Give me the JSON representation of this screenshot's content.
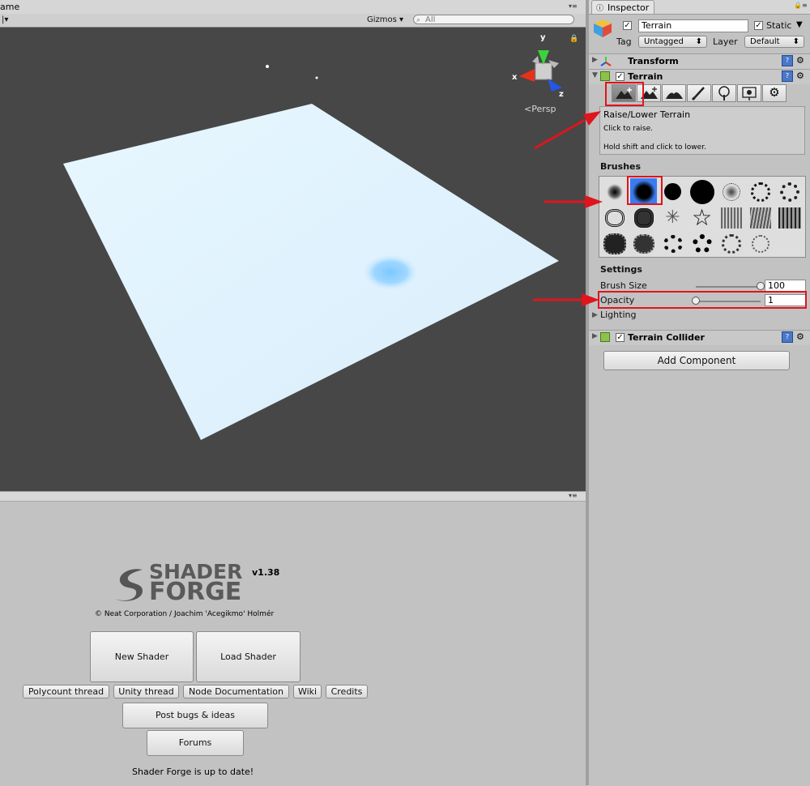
{
  "scene": {
    "tab_title": "ame",
    "toolbar": {
      "gizmos_label": "Gizmos",
      "search_placeholder": "All"
    },
    "gizmo": {
      "y_label": "y",
      "x_label": "x",
      "z_label": "z",
      "persp_label": "Persp"
    }
  },
  "shader_forge": {
    "logo_top": "SHADER",
    "logo_bottom": "FORGE",
    "version": "v1.38",
    "credit": "© Neat Corporation / Joachim 'Acegikmo' Holmér",
    "buttons": {
      "new_shader": "New Shader",
      "load_shader": "Load Shader",
      "polycount": "Polycount thread",
      "unity_thread": "Unity thread",
      "node_docs": "Node Documentation",
      "wiki": "Wiki",
      "credits": "Credits",
      "post_bugs": "Post bugs & ideas",
      "forums": "Forums"
    },
    "status": "Shader Forge is up to date!"
  },
  "inspector": {
    "tab_title": "Inspector",
    "object_name": "Terrain",
    "static_label": "Static",
    "tag_label": "Tag",
    "tag_value": "Untagged",
    "layer_label": "Layer",
    "layer_value": "Default",
    "components": {
      "transform": "Transform",
      "terrain": "Terrain",
      "terrain_collider": "Terrain Collider"
    },
    "tool_info": {
      "title": "Raise/Lower Terrain",
      "line1": "Click to raise.",
      "line2": "Hold shift and click to lower."
    },
    "brushes_label": "Brushes",
    "settings_label": "Settings",
    "brush_size_label": "Brush Size",
    "brush_size_value": "100",
    "brush_size_fraction": 1.0,
    "opacity_label": "Opacity",
    "opacity_value": "1",
    "opacity_fraction": 0.0,
    "lighting_label": "Lighting",
    "add_component": "Add Component"
  },
  "colors": {
    "annotation_red": "#e0141c",
    "viewport_bg": "#474747",
    "terrain_plane": "#e2f3ff",
    "selected_brush": "#3a7cf0"
  }
}
